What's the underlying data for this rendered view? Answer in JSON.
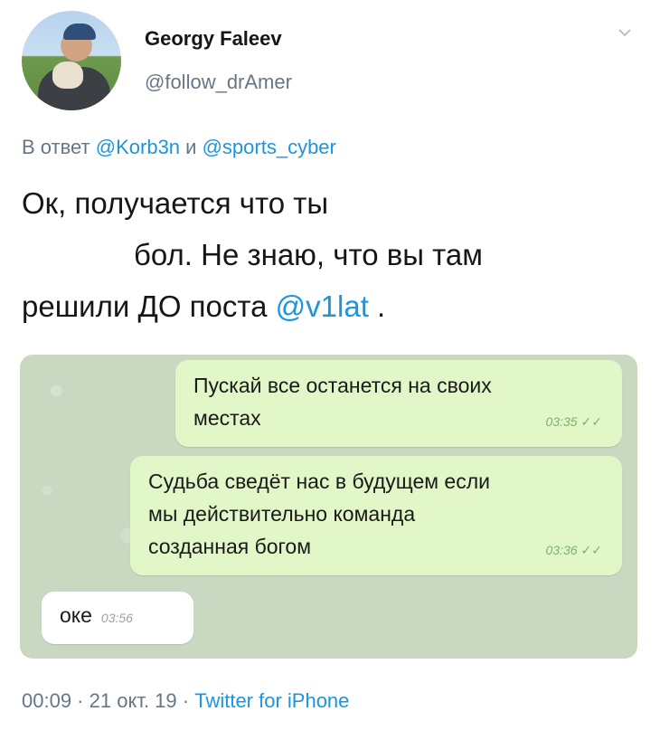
{
  "author": {
    "name": "Georgy Faleev",
    "handle": "@follow_drAmer"
  },
  "reply": {
    "prefix": "В ответ",
    "user1": "@Korb3n",
    "conj": "и",
    "user2": "@sports_cyber"
  },
  "tweet": {
    "line1": "Ок, получается что ты",
    "line2": "бол.  Не знаю, что вы там",
    "line3_text": "решили ДО поста",
    "mention": "@v1lat",
    "line3_end": " ."
  },
  "chat": {
    "messages": [
      {
        "text_a": "Пускай все останется на своих",
        "text_b": "местах",
        "time": "03:35",
        "checks": "✓✓"
      },
      {
        "text_a": "Судьба сведёт нас в будущем если",
        "text_b": "мы действительно команда",
        "text_c": "созданная богом",
        "time": "03:36",
        "checks": "✓✓"
      },
      {
        "text_a": "оке",
        "time": "03:56"
      }
    ]
  },
  "footer": {
    "time": "00:09",
    "sep1": " · ",
    "date": "21 окт. 19",
    "sep2": " · ",
    "source": "Twitter for iPhone"
  },
  "colors": {
    "link": "#1b95e0",
    "outgoing_bubble": "#e1f7c8",
    "chat_background": "#c9d8c0"
  }
}
